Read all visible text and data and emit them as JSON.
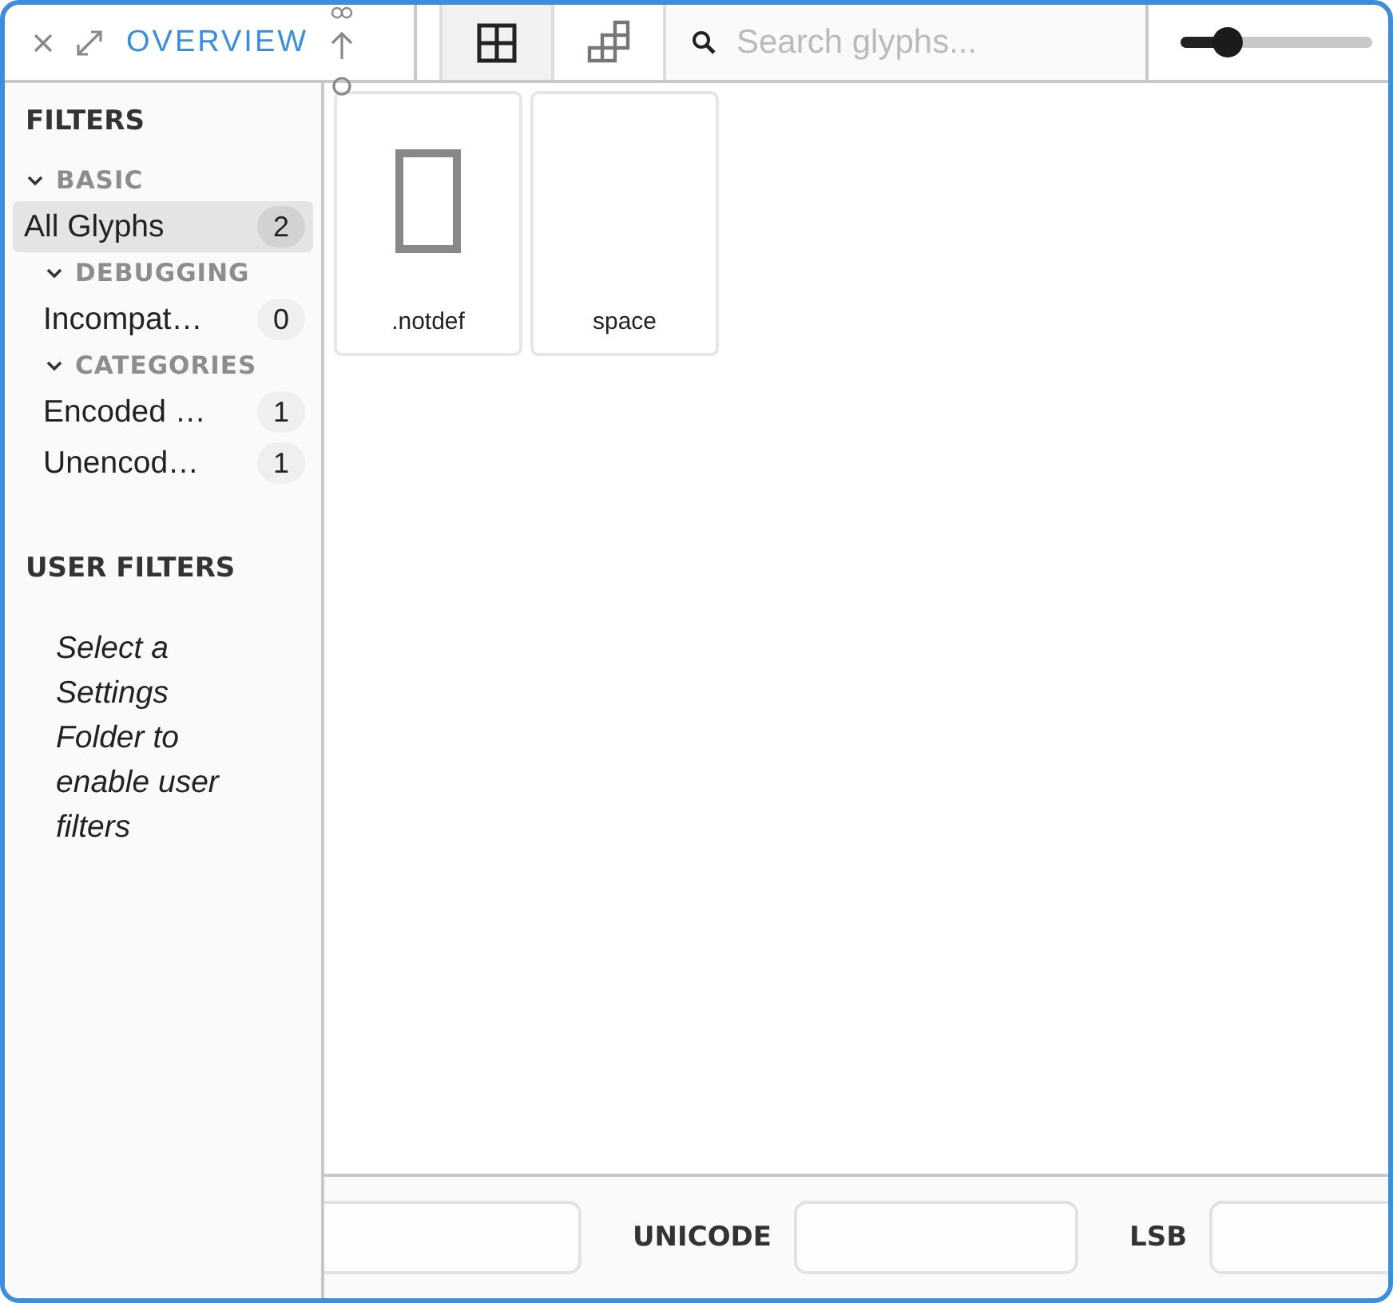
{
  "toolbar": {
    "tab": "OVERVIEW",
    "view_buttons": [
      {
        "kind": "grid",
        "selected": true
      },
      {
        "kind": "tiles",
        "selected": false
      }
    ],
    "search": {
      "placeholder": "Search glyphs..."
    },
    "zoom": {
      "level": 0.24
    }
  },
  "sidebar": {
    "title": "FILTERS",
    "groups": [
      {
        "label": "BASIC",
        "expanded": true,
        "items": [
          {
            "label": "All Glyphs",
            "count": "2",
            "selected": true
          }
        ],
        "children": [
          {
            "label": "DEBUGGING",
            "expanded": true,
            "items": [
              {
                "label": "Incompat…",
                "count": "0",
                "selected": false
              }
            ]
          },
          {
            "label": "CATEGORIES",
            "expanded": true,
            "items": [
              {
                "label": "Encoded …",
                "count": "1",
                "selected": false
              },
              {
                "label": "Unencod…",
                "count": "1",
                "selected": false
              }
            ]
          }
        ]
      }
    ],
    "user_filters": {
      "title": "USER FILTERS",
      "message": "Select a Settings Folder to enable user filters"
    }
  },
  "glyphs": [
    {
      "name": ".notdef",
      "kind": "notdef"
    },
    {
      "name": "space",
      "kind": "blank"
    }
  ],
  "bottom_fields": [
    {
      "kind": "field"
    },
    {
      "kind": "label",
      "text": "UNICODE"
    },
    {
      "kind": "field"
    },
    {
      "kind": "label",
      "text": "LSB"
    },
    {
      "kind": "field"
    }
  ]
}
